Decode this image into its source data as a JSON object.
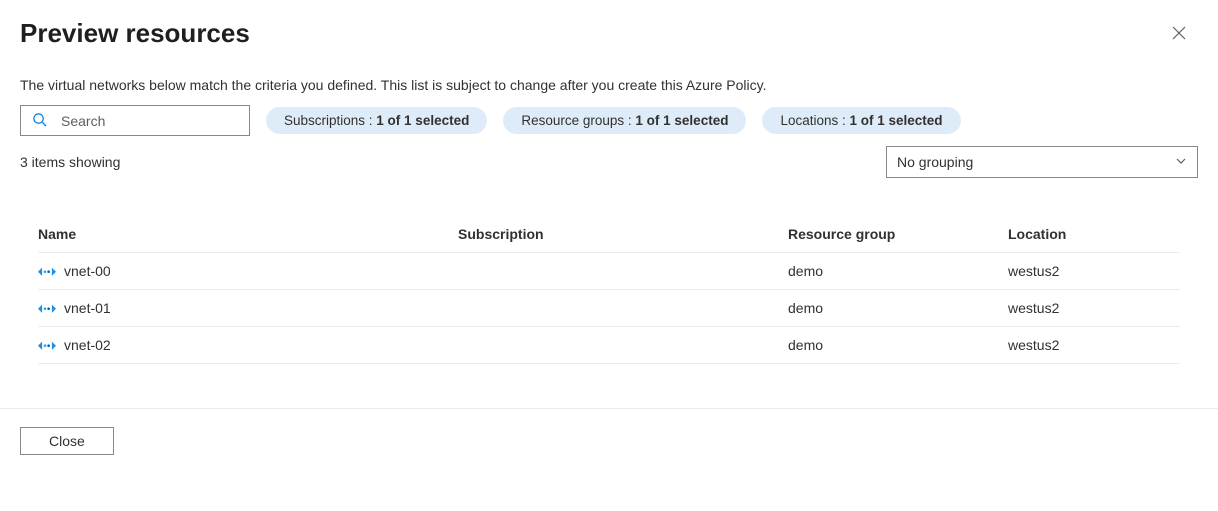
{
  "header": {
    "title": "Preview resources"
  },
  "description": "The virtual networks below match the criteria you defined. This list is subject to change after you create this Azure Policy.",
  "search": {
    "placeholder": "Search"
  },
  "filters": [
    {
      "label": "Subscriptions : ",
      "value": "1 of 1 selected"
    },
    {
      "label": "Resource groups : ",
      "value": "1 of 1 selected"
    },
    {
      "label": "Locations : ",
      "value": "1 of 1 selected"
    }
  ],
  "count_text": "3 items showing",
  "grouping": {
    "selected": "No grouping"
  },
  "columns": {
    "name": "Name",
    "subscription": "Subscription",
    "resource_group": "Resource group",
    "location": "Location"
  },
  "rows": [
    {
      "name": "vnet-00",
      "subscription": "",
      "resource_group": "demo",
      "location": "westus2"
    },
    {
      "name": "vnet-01",
      "subscription": "",
      "resource_group": "demo",
      "location": "westus2"
    },
    {
      "name": "vnet-02",
      "subscription": "",
      "resource_group": "demo",
      "location": "westus2"
    }
  ],
  "footer": {
    "close": "Close"
  }
}
